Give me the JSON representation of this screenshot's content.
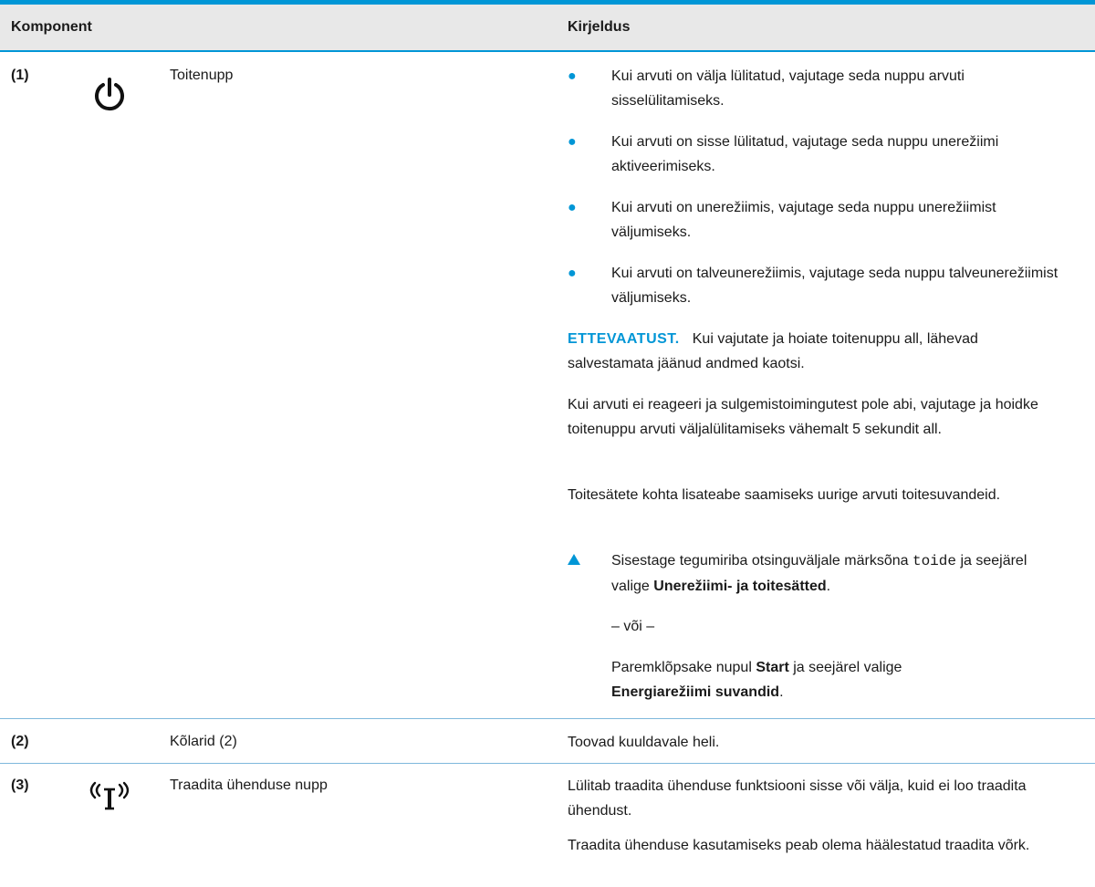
{
  "table": {
    "header": {
      "component": "Komponent",
      "description": "Kirjeldus"
    },
    "rows": [
      {
        "number": "(1)",
        "icon": "power-icon",
        "name": "Toitenupp",
        "bullets": [
          "Kui arvuti on välja lülitatud, vajutage seda nuppu arvuti sisselülitamiseks.",
          "Kui arvuti on sisse lülitatud, vajutage seda nuppu unerežiimi aktiveerimiseks.",
          "Kui arvuti on unerežiimis, vajutage seda nuppu unerežiimist väljumiseks.",
          "Kui arvuti on talveunerežiimis, vajutage seda nuppu talveunerežiimist väljumiseks."
        ],
        "caution_label": "ETTEVAATUST.",
        "caution_text": "Kui vajutate ja hoiate toitenuppu all, lähevad salvestamata jäänud andmed kaotsi.",
        "para1": "Kui arvuti ei reageeri ja sulgemistoimingutest pole abi, vajutage ja hoidke toitenuppu arvuti väljalülitamiseks vähemalt 5 sekundit all.",
        "para2": "Toitesätete kohta lisateabe saamiseks uurige arvuti toitesuvandeid.",
        "step": {
          "text_before": "Sisestage tegumiriba otsinguväljale märksõna",
          "code": "toide",
          "text_middle": "ja seejärel valige",
          "bold": "Unerežiimi- ja toitesätted",
          "end": "."
        },
        "or": "– või –",
        "alt": {
          "text1": "Paremklõpsake nupul",
          "bold1": "Start",
          "text2": "ja seejärel valige",
          "bold2": "Energiarežiimi suvandid",
          "end": "."
        }
      },
      {
        "number": "(2)",
        "name": "Kõlarid (2)",
        "description": "Toovad kuuldavale heli."
      },
      {
        "number": "(3)",
        "icon": "wireless-icon",
        "name": "Traadita ühenduse nupp",
        "para1": "Lülitab traadita ühenduse funktsiooni sisse või välja, kuid ei loo traadita ühendust.",
        "para2": "Traadita ühenduse kasutamiseks peab olema häälestatud traadita võrk."
      }
    ]
  },
  "colors": {
    "accent": "#0096d6",
    "header_bg": "#e8e8e8",
    "divider": "#7fb8dc"
  }
}
